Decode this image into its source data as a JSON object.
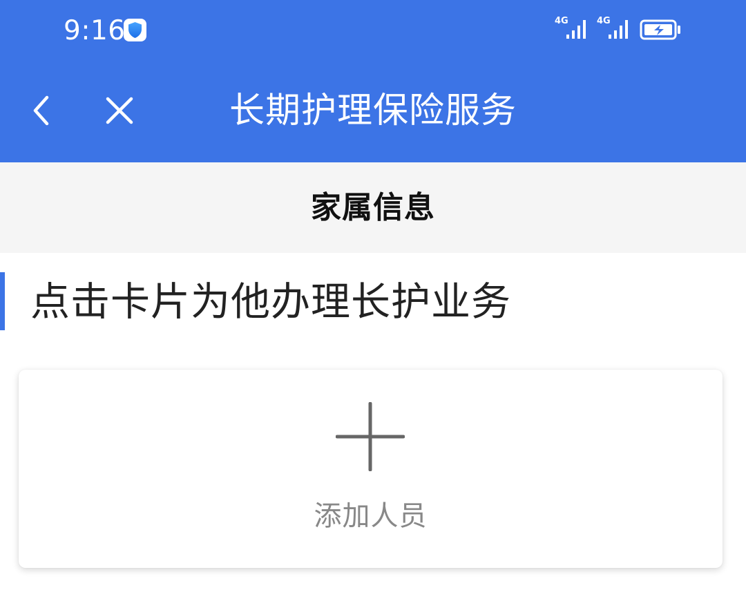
{
  "status_bar": {
    "time": "9:16",
    "shield_icon": "shield-icon",
    "signals": [
      {
        "network": "4G",
        "icon": "signal-bars-icon"
      },
      {
        "network": "4G",
        "icon": "signal-bars-icon"
      }
    ],
    "battery_icon": "battery-charging-icon"
  },
  "nav": {
    "back_icon": "chevron-left-icon",
    "close_icon": "close-icon",
    "title": "长期护理保险服务"
  },
  "section": {
    "title": "家属信息"
  },
  "instruction": {
    "text": "点击卡片为他办理长护业务"
  },
  "add_card": {
    "icon": "plus-icon",
    "label": "添加人员"
  },
  "colors": {
    "primary": "#3c74e6",
    "header_bg": "#f5f5f5",
    "card_label": "#888888",
    "icon_gray": "#666666"
  }
}
